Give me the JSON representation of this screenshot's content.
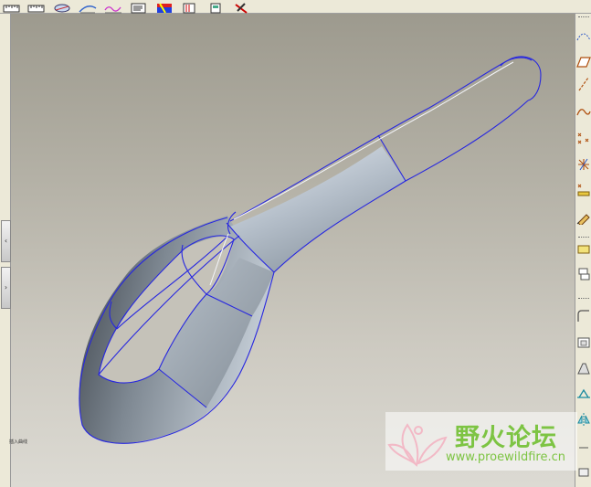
{
  "status": {
    "message": "插入曲线"
  },
  "watermark": {
    "title": "野火论坛",
    "url": "www.proewildfire.cn"
  },
  "top_toolbar": {
    "icons": [
      "ruler-icon",
      "ruler-icon",
      "analysis-icon",
      "curvature-icon",
      "graph-icon",
      "report-icon",
      "color-map-icon",
      "dimension-icon",
      "file-icon",
      "no-tool-icon"
    ]
  },
  "right_toolbar": {
    "icons": [
      "datum-curve-dashed-icon",
      "datum-plane-icon",
      "datum-axis-icon",
      "sketch-curve-icon",
      "datum-point-icon",
      "datum-csys-icon",
      "offset-point-icon",
      "sketch-pen-icon",
      "rectangle-icon",
      "copy-icon",
      "round-icon",
      "shell-icon",
      "draft-icon",
      "rib-icon",
      "mirror-icon"
    ]
  },
  "colors": {
    "curve": "#2626e0",
    "viewport_top": "#9d9a8e",
    "viewport_bottom": "#dcdad3",
    "watermark_text": "#7dc443"
  }
}
